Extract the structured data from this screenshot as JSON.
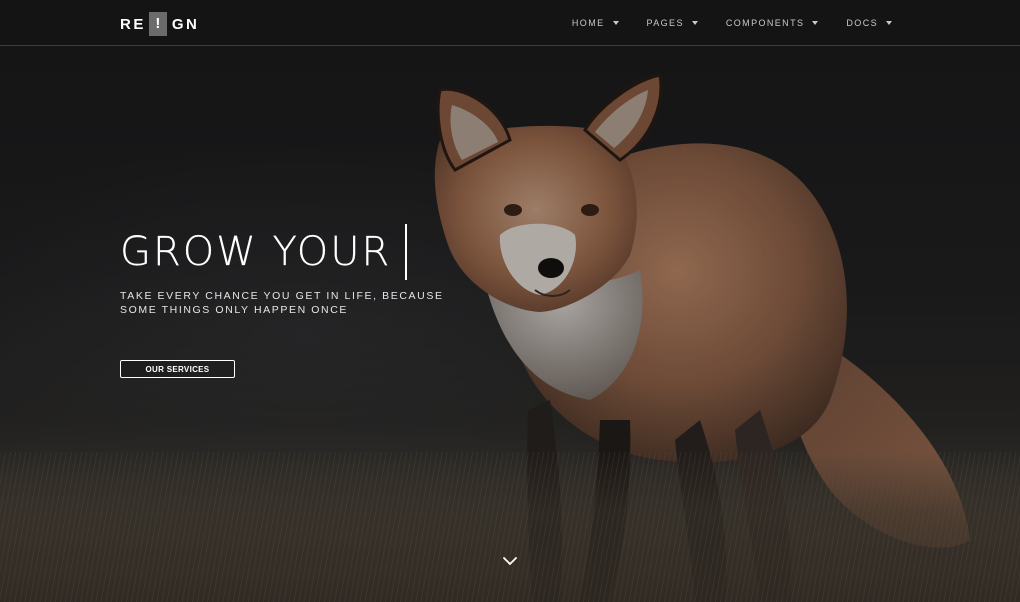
{
  "brand": {
    "logo_left": "RE",
    "logo_mark": "!",
    "logo_right": "GN"
  },
  "nav": {
    "items": [
      {
        "label": "HOME",
        "icon": "chevron-down-icon"
      },
      {
        "label": "PAGES",
        "icon": "chevron-down-icon"
      },
      {
        "label": "COMPONENTS",
        "icon": "chevron-down-icon"
      },
      {
        "label": "DOCS",
        "icon": "chevron-down-icon"
      }
    ]
  },
  "hero": {
    "title": "GROW YOUR",
    "subtitle_line1": "TAKE EVERY CHANCE YOU GET IN LIFE, BECAUSE",
    "subtitle_line2": "SOME THINGS ONLY HAPPEN ONCE",
    "cta_label": "OUR SERVICES",
    "scroll_icon": "chevron-down-icon",
    "background_image": "fox-photo"
  },
  "colors": {
    "text": "#ffffff",
    "nav_text": "#c9c9c9",
    "logo_mark_bg": "#6b6b6b",
    "background": "#1b1b1c"
  }
}
